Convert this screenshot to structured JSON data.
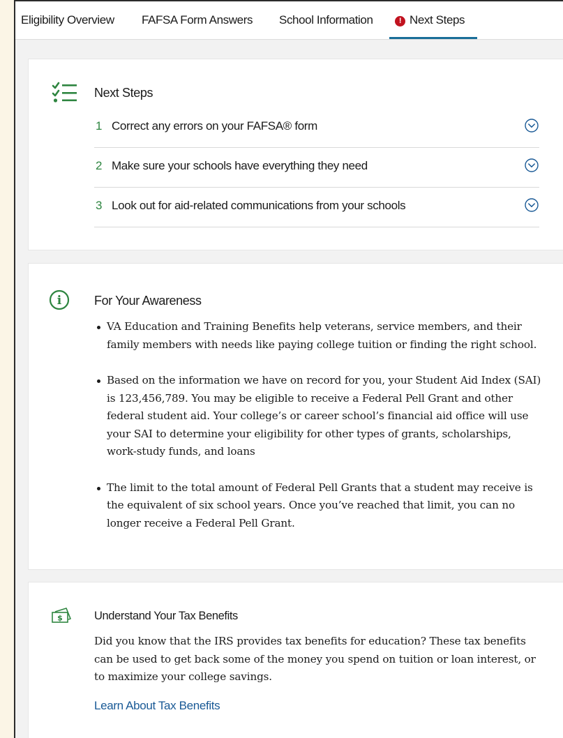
{
  "tabs": [
    {
      "label": "Eligibility Overview",
      "active": false
    },
    {
      "label": "FAFSA Form Answers",
      "active": false
    },
    {
      "label": "School Information",
      "active": false
    },
    {
      "label": "Next Steps",
      "active": true,
      "alert": "!"
    }
  ],
  "next_steps": {
    "title": "Next Steps",
    "items": [
      {
        "number": "1",
        "text": "Correct any errors on your FAFSA® form"
      },
      {
        "number": "2",
        "text": "Make sure your schools have everything they need"
      },
      {
        "number": "3",
        "text": "Look out for aid-related communications from your schools"
      }
    ]
  },
  "awareness": {
    "title": "For Your Awareness",
    "bullets": [
      "VA Education and Training Benefits help veterans, service members, and their family members with needs like paying college tuition or finding the right school.",
      "Based on the information we have on record for you, your Student Aid Index (SAI) is 123,456,789. You may be eligible to receive a Federal Pell Grant and other federal student aid. Your college’s or career school’s financial aid office will use your SAI to determine your eligibility for other types of grants, scholarships, work-study funds, and loans",
      "The limit to the total amount of Federal Pell Grants that a student may receive is the equivalent of six school years. Once you’ve reached that limit, you can no longer receive a Federal Pell Grant."
    ]
  },
  "tax": {
    "title": "Understand Your Tax Benefits",
    "body": "Did you know that the IRS provides tax benefits for education? These tax benefits can be used to get back some of the money you spend on tuition or loan interest, or to maximize your college savings.",
    "link_label": "Learn About Tax Benefits"
  },
  "colors": {
    "accent_green": "#2e8540",
    "tab_underline": "#1a6e99",
    "alert_red": "#c1121f",
    "link_blue": "#1a5a96"
  },
  "icons": {
    "next_steps": "checklist-icon",
    "awareness": "info-circle-icon",
    "tax": "money-bill-icon",
    "expand": "chevron-down-circle-icon",
    "tab_alert": "alert-icon"
  }
}
